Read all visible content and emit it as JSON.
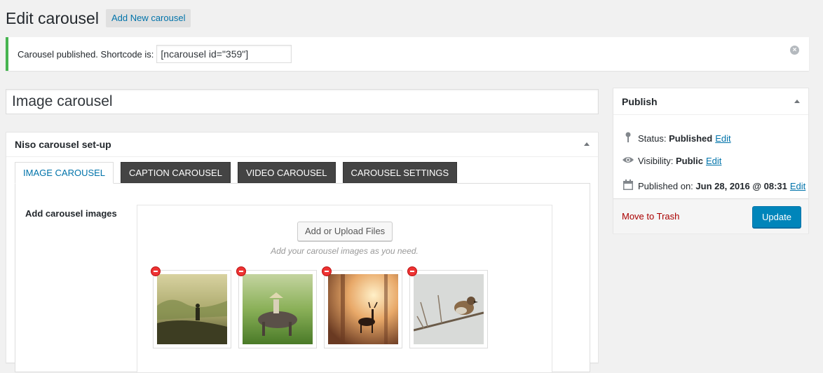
{
  "heading": {
    "title": "Edit carousel",
    "add_new_label": "Add New carousel"
  },
  "notice": {
    "text": "Carousel published. Shortcode is:",
    "shortcode": "[ncarousel id=\"359\"]"
  },
  "post": {
    "title": "Image carousel"
  },
  "setup_box": {
    "title": "Niso carousel set-up",
    "tabs": [
      {
        "label": "IMAGE CAROUSEL",
        "active": true
      },
      {
        "label": "CAPTION CAROUSEL",
        "active": false
      },
      {
        "label": "VIDEO CAROUSEL",
        "active": false
      },
      {
        "label": "CAROUSEL SETTINGS",
        "active": false
      }
    ],
    "field_label": "Add carousel images",
    "upload_button": "Add or Upload Files",
    "upload_hint": "Add your carousel images as you need.",
    "images": [
      {
        "subject": "person walking in misty field",
        "colors": [
          "#c8c28a",
          "#6e7a3a",
          "#3a3a22"
        ]
      },
      {
        "subject": "boy riding water buffalo",
        "colors": [
          "#9bbd6a",
          "#5a8a32",
          "#3d4a2a"
        ]
      },
      {
        "subject": "deer in golden forest",
        "colors": [
          "#e8b06a",
          "#c0803a",
          "#5a3a22"
        ]
      },
      {
        "subject": "sparrow on frosty branch",
        "colors": [
          "#dcdcd8",
          "#a8aaa8",
          "#6a5a48"
        ]
      }
    ]
  },
  "publish": {
    "title": "Publish",
    "status_label": "Status:",
    "status_value": "Published",
    "visibility_label": "Visibility:",
    "visibility_value": "Public",
    "published_label": "Published on:",
    "published_value": "Jun 28, 2016 @ 08:31",
    "edit_label": "Edit",
    "trash_label": "Move to Trash",
    "update_label": "Update"
  },
  "colors": {
    "accent": "#0073aa",
    "success": "#46b450",
    "danger": "#a00",
    "primary_button": "#0085ba"
  }
}
